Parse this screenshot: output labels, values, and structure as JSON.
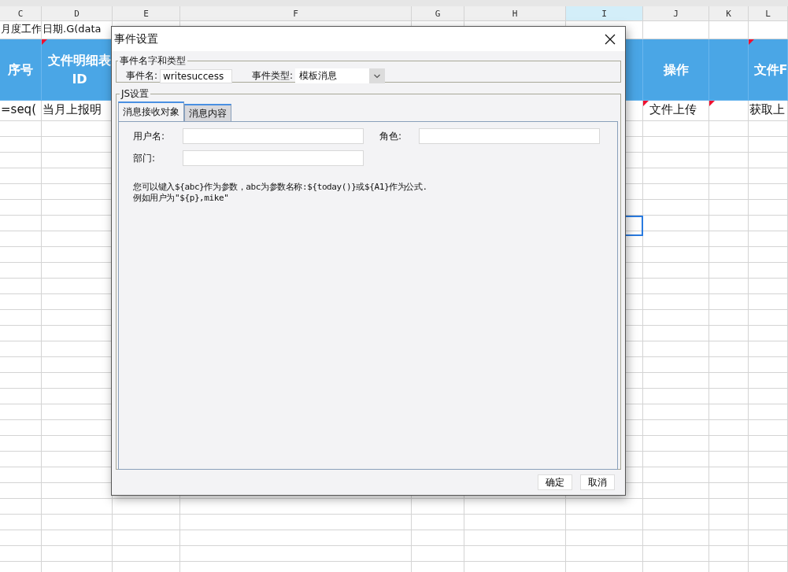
{
  "sheet": {
    "columns": [
      {
        "label": "C",
        "selected": false
      },
      {
        "label": "D",
        "selected": false
      },
      {
        "label": "E",
        "selected": false
      },
      {
        "label": "F",
        "selected": false
      },
      {
        "label": "G",
        "selected": false
      },
      {
        "label": "H",
        "selected": false
      },
      {
        "label": "I",
        "selected": true
      },
      {
        "label": "J",
        "selected": false
      },
      {
        "label": "K",
        "selected": false
      },
      {
        "label": "L",
        "selected": false
      }
    ],
    "rows": [
      {
        "kind": "plain",
        "cells": [
          {
            "text": "月度工作",
            "comment": false
          },
          {
            "text": "日期.G(data",
            "comment": false
          },
          {
            "comment": false
          },
          {
            "comment": false
          },
          {
            "comment": false
          },
          {
            "comment": false
          },
          {
            "comment": false
          },
          {
            "comment": false
          },
          {
            "comment": false
          },
          {
            "comment": false
          }
        ]
      },
      {
        "kind": "header",
        "cells": [
          {
            "text": "序号",
            "comment": false
          },
          {
            "text": "文件明细表\nID",
            "comment": true
          },
          {},
          {},
          {},
          {},
          {},
          {
            "text": "操作",
            "comment": false
          },
          {
            "comment": false
          },
          {
            "text": "文件F",
            "comment": true
          }
        ]
      },
      {
        "kind": "plain",
        "cells": [
          {
            "text": "=seq(",
            "comment": false
          },
          {
            "text": "当月上报明",
            "comment": false
          },
          {},
          {},
          {},
          {},
          {},
          {
            "text": "文件上传",
            "comment": true
          },
          {
            "comment": true
          },
          {
            "text": "获取上",
            "comment": false
          }
        ]
      }
    ]
  },
  "dialog": {
    "title": "事件设置",
    "name_group": {
      "legend": "事件名字和类型",
      "name_label": "事件名:",
      "name_value": "writesuccess",
      "type_label": "事件类型:",
      "type_value": "模板消息"
    },
    "js_group": {
      "legend": "JS设置",
      "tabs": [
        {
          "label": "消息接收对象",
          "selected": true
        },
        {
          "label": "消息内容",
          "selected": false
        }
      ],
      "fields": [
        {
          "label": "用户名:"
        },
        {
          "label": "角色:"
        },
        {
          "label": "部门:"
        }
      ],
      "help": [
        "您可以键入${abc}作为参数，abc为参数名称:${today()}或${A1}作为公式.",
        "例如用户为\"${p},mike\""
      ]
    },
    "buttons": [
      "确定",
      "取消"
    ]
  }
}
